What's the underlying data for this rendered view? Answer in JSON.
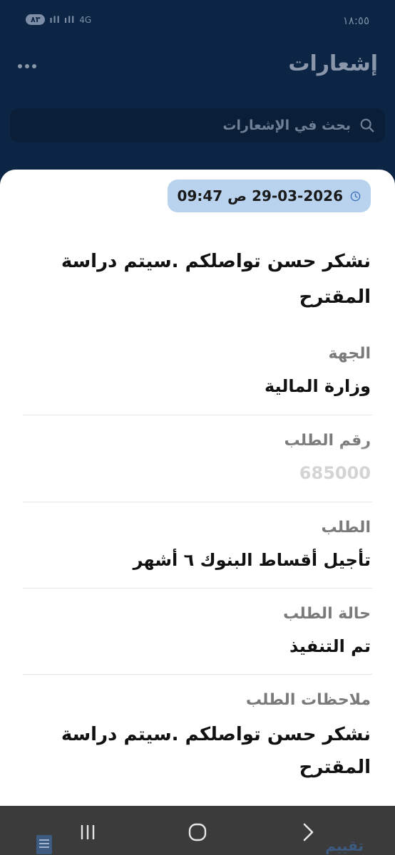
{
  "status_bar": {
    "time": "١٨:٥٥",
    "battery": "٨٣",
    "network": "4G"
  },
  "header": {
    "title": "إشعارات"
  },
  "search": {
    "placeholder": "بحث في الإشعارات"
  },
  "notification": {
    "datetime": "29-03-2026 ص 09:47",
    "message": "نشكر حسن تواصلكم .سيتم دراسة المقترح",
    "fields": [
      {
        "label": "الجهة",
        "value": "وزارة المالية"
      },
      {
        "label": "رقم الطلب",
        "value": "685000"
      },
      {
        "label": "الطلب",
        "value": "تأجيل أقساط البنوك ٦ أشهر"
      },
      {
        "label": "حالة الطلب",
        "value": "تم التنفيذ"
      },
      {
        "label": "ملاحظات الطلب",
        "value": "نشكر حسن تواصلكم .سيتم دراسة المقترح"
      }
    ]
  },
  "bottom_nav": {
    "rate_label": "تقييم"
  }
}
